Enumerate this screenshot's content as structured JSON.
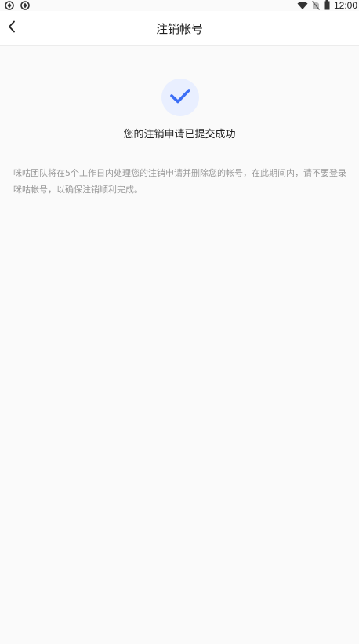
{
  "status_bar": {
    "left_icons": [
      "sync-icon",
      "sync-icon"
    ],
    "right_icons": [
      "wifi-icon",
      "no-sim-icon",
      "battery-icon"
    ],
    "time": "12:00"
  },
  "nav": {
    "back_icon": "chevron-left-icon",
    "title": "注销帐号"
  },
  "result": {
    "icon": "check-icon",
    "accent_color": "#3b6ef6",
    "badge_color": "#e9efff",
    "title": "您的注销申请已提交成功",
    "description": "咪咕团队将在5个工作日内处理您的注销申请并删除您的帐号，在此期间内，请不要登录咪咕帐号，以确保注销顺利完成。"
  }
}
